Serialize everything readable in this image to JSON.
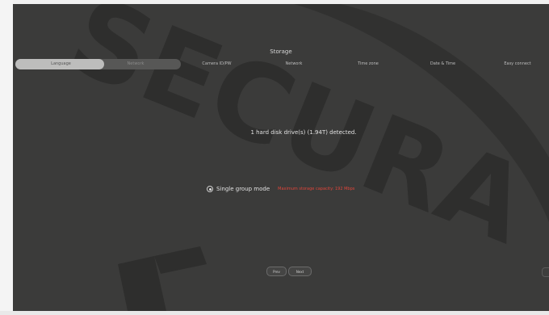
{
  "title": "Storage",
  "wizard": {
    "steps": [
      {
        "label": "Language"
      },
      {
        "label": "Network"
      },
      {
        "label": "Camera ID/PW"
      },
      {
        "label": "Network"
      },
      {
        "label": "Time zone"
      },
      {
        "label": "Date & Time"
      },
      {
        "label": "Easy connect"
      }
    ],
    "progress_fraction": 0.29
  },
  "detected_text": "1 hard disk drive(s) (1.94T) detected.",
  "mode": {
    "label": "Single group mode",
    "selected": true,
    "capacity_text": "Maximum storage capacity: 192 Mbps"
  },
  "buttons": {
    "prev": "Prev",
    "next": "Next"
  },
  "watermark_text": "SECURA",
  "colors": {
    "background": "#3b3b3a",
    "accent_red": "#e0453a",
    "progress_fill": "#bdbdbc"
  }
}
